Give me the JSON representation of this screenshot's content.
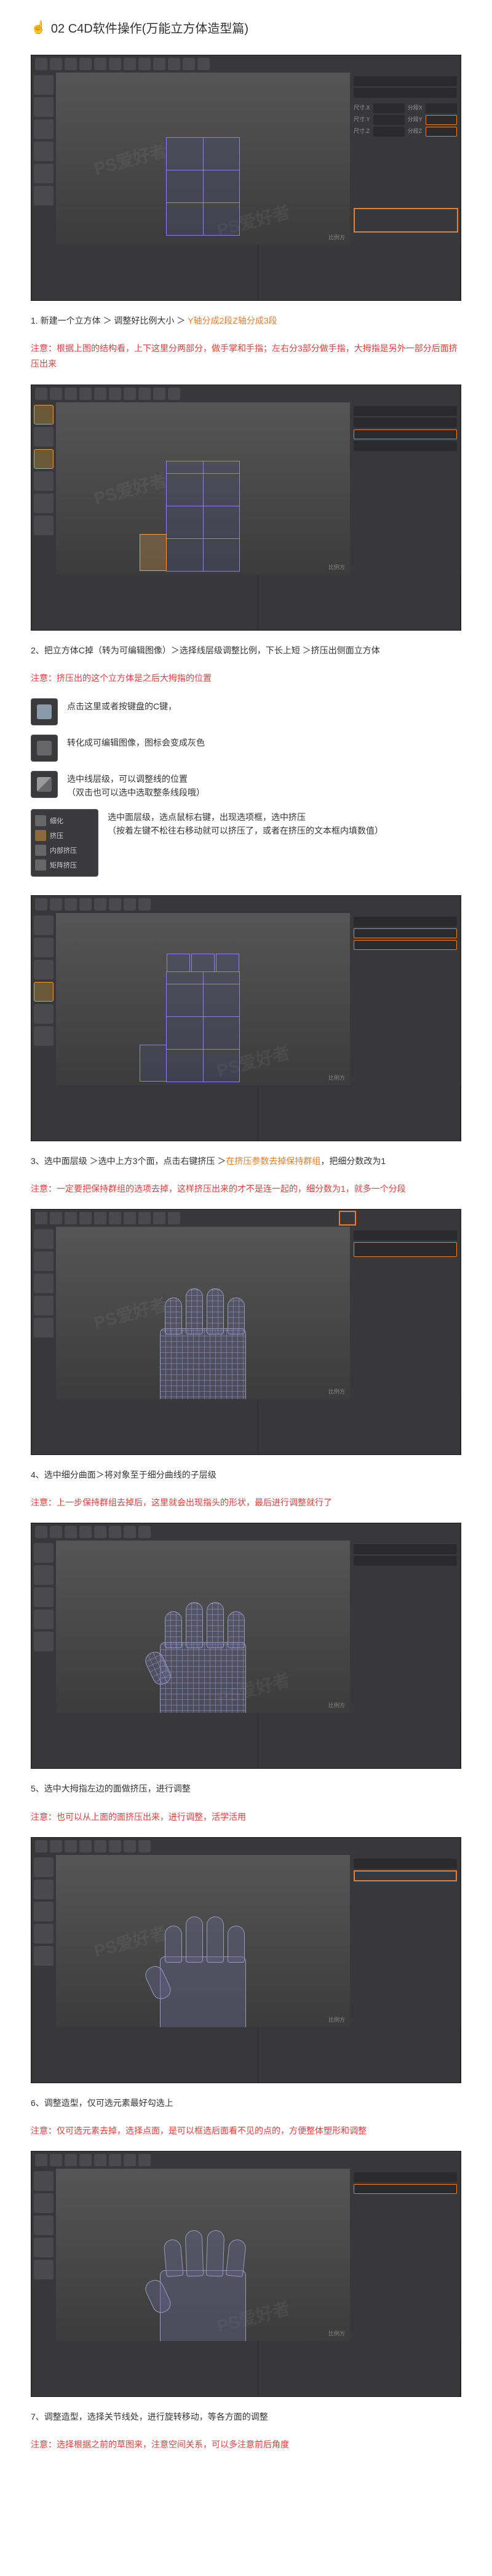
{
  "section_title": "02 C4D软件操作(万能立方体造型篇)",
  "steps": [
    {
      "num": "1",
      "text_main": "新建一个立方体 ＞ 调整好比例大小 ＞ ",
      "text_hl": "Y轴分成2段Z轴分成3段",
      "note": "注意：根据上图的结构看，上下这里分两部分，做手掌和手指；左右分3部分做手指，大拇指是另外一部分后面挤压出来"
    },
    {
      "num": "2",
      "text_main": "把立方体C掉（转为可编辑图像）＞选择线层级调整比例，下长上短 ＞挤压出侧面立方体",
      "note": "注意：挤压出的这个立方体是之后大拇指的位置"
    },
    {
      "num": "3",
      "text_main": "选中面层级 ＞选中上方3个面，点击右键挤压 ＞",
      "text_hl": "在挤压参数去掉保持群组",
      "text_tail": "，把细分数改为1",
      "note": "注意：一定要把保持群组的选项去掉，这样挤压出来的才不是连一起的，细分数为1，就多一个分段"
    },
    {
      "num": "4",
      "text_main": "选中细分曲面＞将对象至于细分曲线的子层级",
      "note": "注意：上一步保持群组去掉后，这里就会出现指头的形状，最后进行调整就行了"
    },
    {
      "num": "5",
      "text_main": "选中大拇指左边的面做挤压，进行调整",
      "note": "注意：也可以从上面的面挤压出来，进行调整，活学活用"
    },
    {
      "num": "6",
      "text_main": "调整造型，仅可选元素最好勾选上",
      "note": "注意：仅可选元素去掉，选择点面，是可以框选后面看不见的点的，方便整体塑形和调整"
    },
    {
      "num": "7",
      "text_main": "调整造型，选择关节线处，进行旋转移动，等各方面的调整",
      "note": "注意：选择根据之前的草图来，注意空间关系，可以多注意前后角度"
    }
  ],
  "icon_rows": [
    {
      "text": "点击这里或者按键盘的C键，"
    },
    {
      "text": "转化成可编辑图像，图标会变成灰色"
    },
    {
      "text": "选中线层级，可以调整线的位置\n（双击也可以选中选取整条线段哦）"
    }
  ],
  "panel_desc": {
    "line1": "选中面层级，选点鼠标右键，出现选项框，选中挤压",
    "line2": "（按着左键不松往右移动就可以挤压了，或者在挤压的文本框内填数值）"
  },
  "panel_items": [
    "细化",
    "挤压",
    "内部挤压",
    "矩阵挤压"
  ],
  "c4d_labels": {
    "size_x": "尺寸.X",
    "size_y": "尺寸.Y",
    "size_z": "尺寸.Z",
    "seg_x": "分段X",
    "seg_y": "分段Y",
    "seg_z": "分段Z",
    "ratio": "比例方"
  },
  "watermark": "PS爱好者"
}
